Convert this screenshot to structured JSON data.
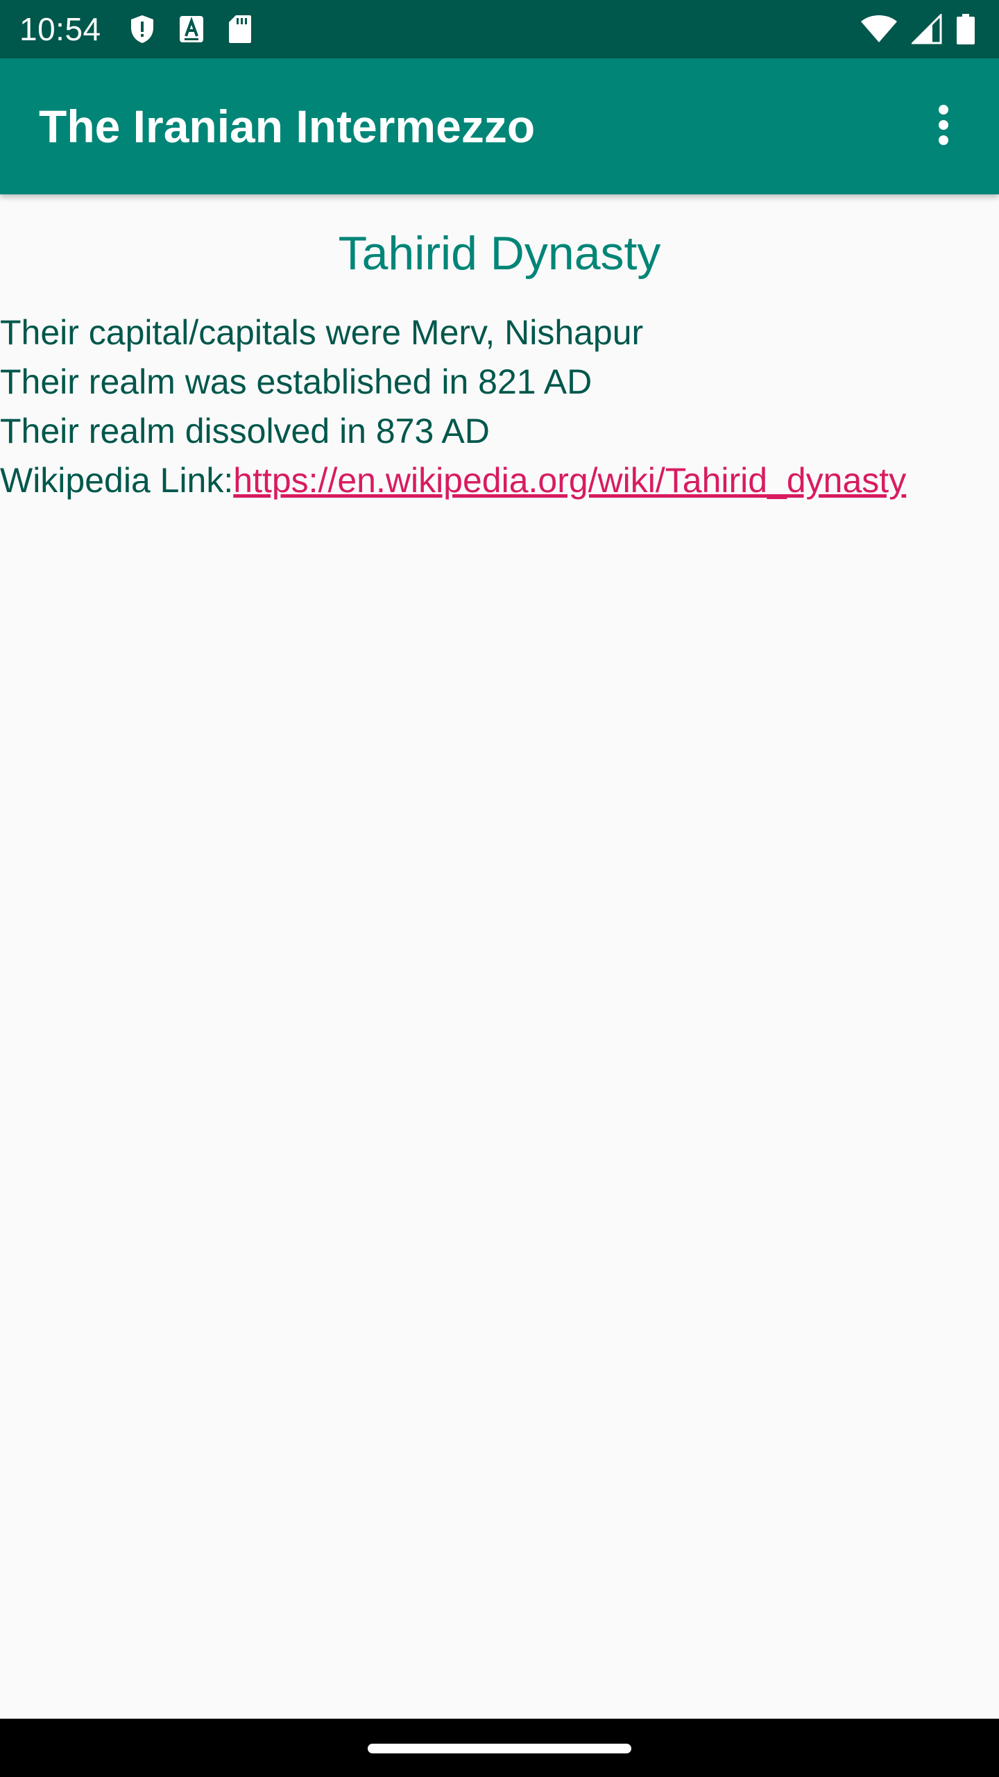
{
  "status_bar": {
    "time": "10:54",
    "icons": [
      "shield-icon",
      "font-a-icon",
      "sd-card-icon",
      "wifi-icon",
      "signal-icon",
      "battery-icon"
    ]
  },
  "app_bar": {
    "title": "The Iranian Intermezzo",
    "menu_icon": "more-vert-icon"
  },
  "content": {
    "dynasty_name": "Tahirid Dynasty",
    "capitals": "Their capital/capitals were Merv, Nishapur",
    "established": "Their realm was established in 821 AD",
    "dissolved": "Their realm dissolved in 873 AD",
    "wiki_label": "Wikipedia Link:",
    "wiki_url": "https://en.wikipedia.org/wiki/Tahirid_dynasty"
  },
  "colors": {
    "status_bar": "#00574b",
    "app_bar": "#008577",
    "title_text": "#008577",
    "body_text": "#00574b",
    "link": "#d81b60",
    "background": "#fafafa"
  }
}
